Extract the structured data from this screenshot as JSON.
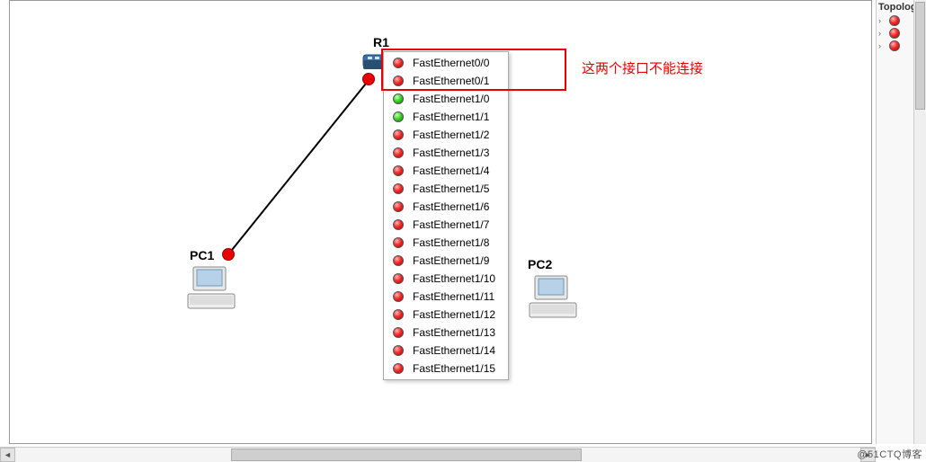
{
  "devices": {
    "router": {
      "label": "R1"
    },
    "pc1": {
      "label": "PC1"
    },
    "pc2": {
      "label": "PC2"
    }
  },
  "callout": {
    "text": "这两个接口不能连接"
  },
  "port_menu": {
    "items": [
      {
        "label": "FastEthernet0/0",
        "status": "red"
      },
      {
        "label": "FastEthernet0/1",
        "status": "red"
      },
      {
        "label": "FastEthernet1/0",
        "status": "green"
      },
      {
        "label": "FastEthernet1/1",
        "status": "green"
      },
      {
        "label": "FastEthernet1/2",
        "status": "red"
      },
      {
        "label": "FastEthernet1/3",
        "status": "red"
      },
      {
        "label": "FastEthernet1/4",
        "status": "red"
      },
      {
        "label": "FastEthernet1/5",
        "status": "red"
      },
      {
        "label": "FastEthernet1/6",
        "status": "red"
      },
      {
        "label": "FastEthernet1/7",
        "status": "red"
      },
      {
        "label": "FastEthernet1/8",
        "status": "red"
      },
      {
        "label": "FastEthernet1/9",
        "status": "red"
      },
      {
        "label": "FastEthernet1/10",
        "status": "red"
      },
      {
        "label": "FastEthernet1/11",
        "status": "red"
      },
      {
        "label": "FastEthernet1/12",
        "status": "red"
      },
      {
        "label": "FastEthernet1/13",
        "status": "red"
      },
      {
        "label": "FastEthernet1/14",
        "status": "red"
      },
      {
        "label": "FastEthernet1/15",
        "status": "red"
      }
    ]
  },
  "side_panel": {
    "title": "Topology",
    "rows": [
      {
        "status": "red"
      },
      {
        "status": "red"
      },
      {
        "status": "red"
      }
    ]
  },
  "watermark": "@51CTQ博客"
}
